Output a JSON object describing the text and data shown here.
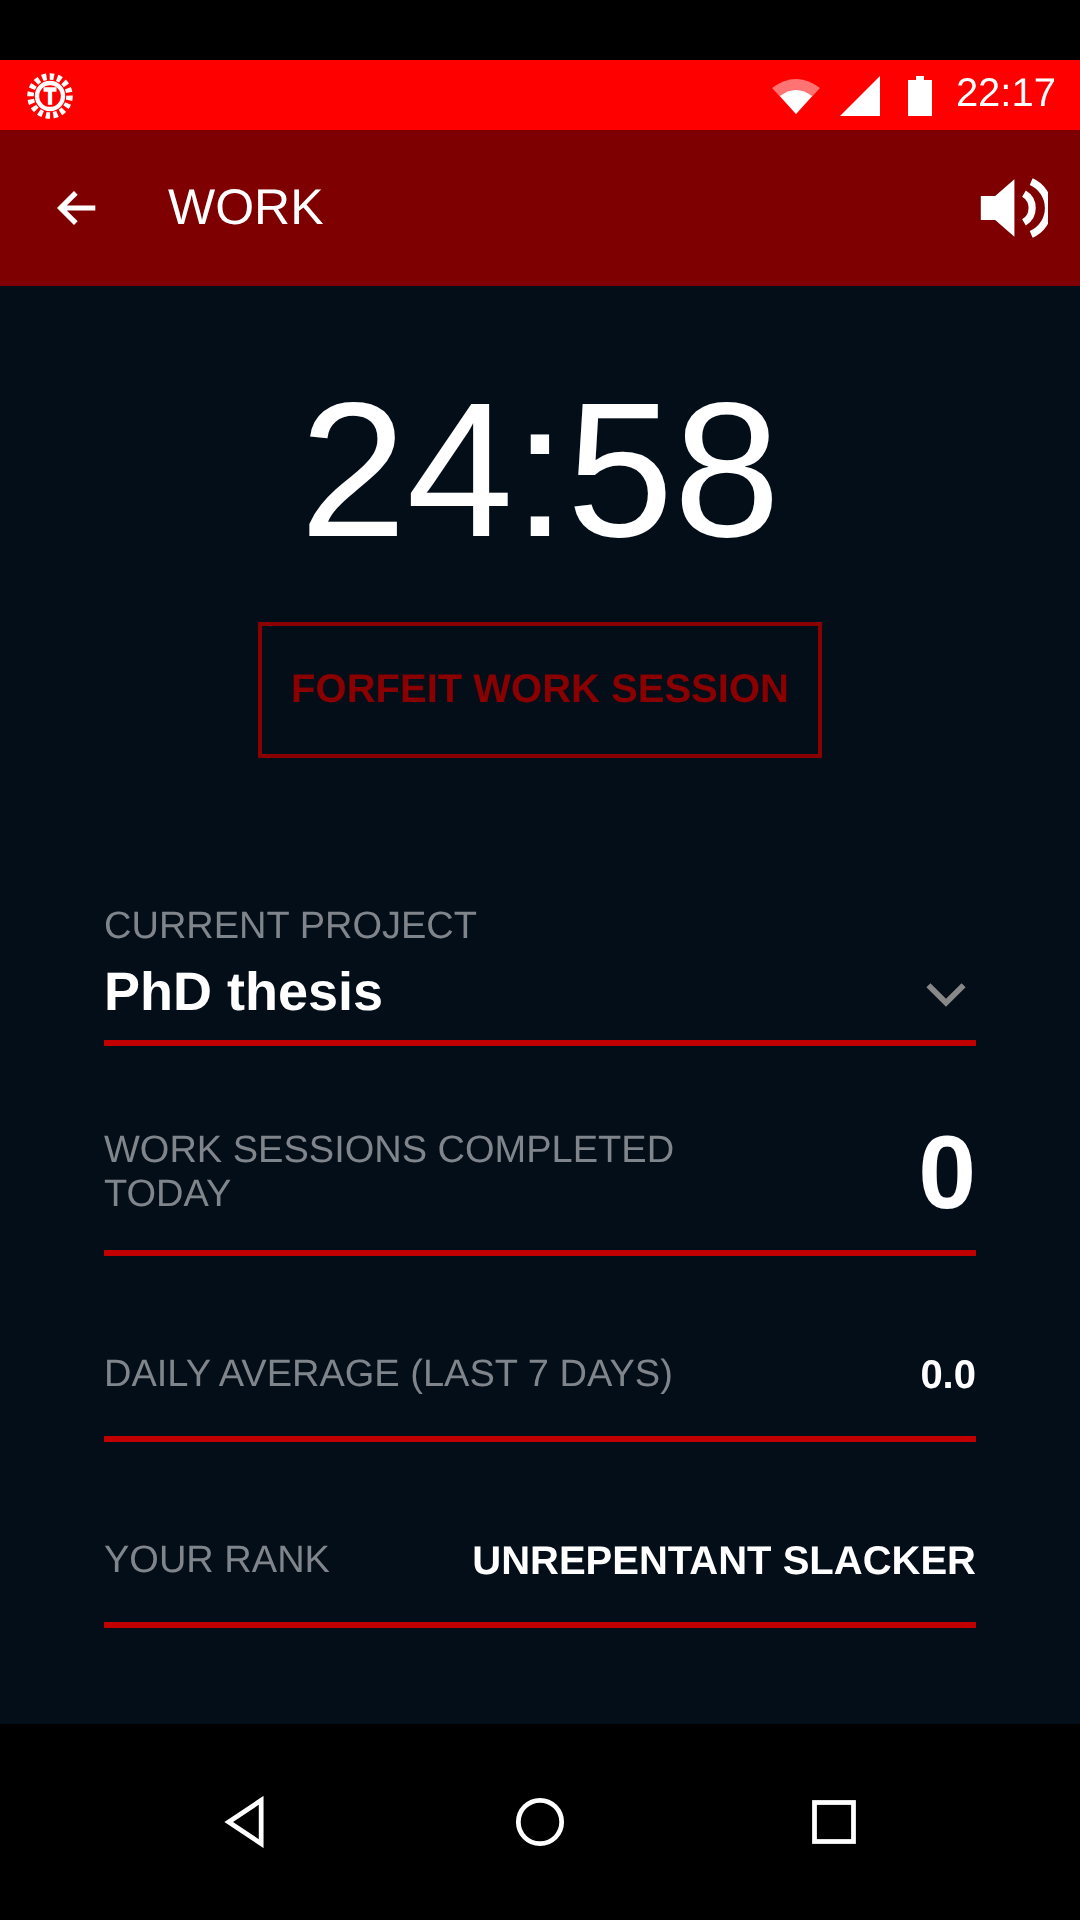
{
  "status_bar": {
    "time": "22:17"
  },
  "app_bar": {
    "title": "WORK"
  },
  "timer": "24:58",
  "forfeit_button": "FORFEIT WORK SESSION",
  "project": {
    "label": "CURRENT PROJECT",
    "value": "PhD thesis"
  },
  "stats": [
    {
      "kind": "large",
      "label": "WORK SESSIONS COMPLETED TODAY",
      "value": "0"
    },
    {
      "kind": "small",
      "label": "DAILY AVERAGE (LAST 7 DAYS)",
      "value": "0.0"
    },
    {
      "kind": "small",
      "label": "YOUR RANK",
      "value": "UNREPENTANT SLACKER"
    }
  ]
}
